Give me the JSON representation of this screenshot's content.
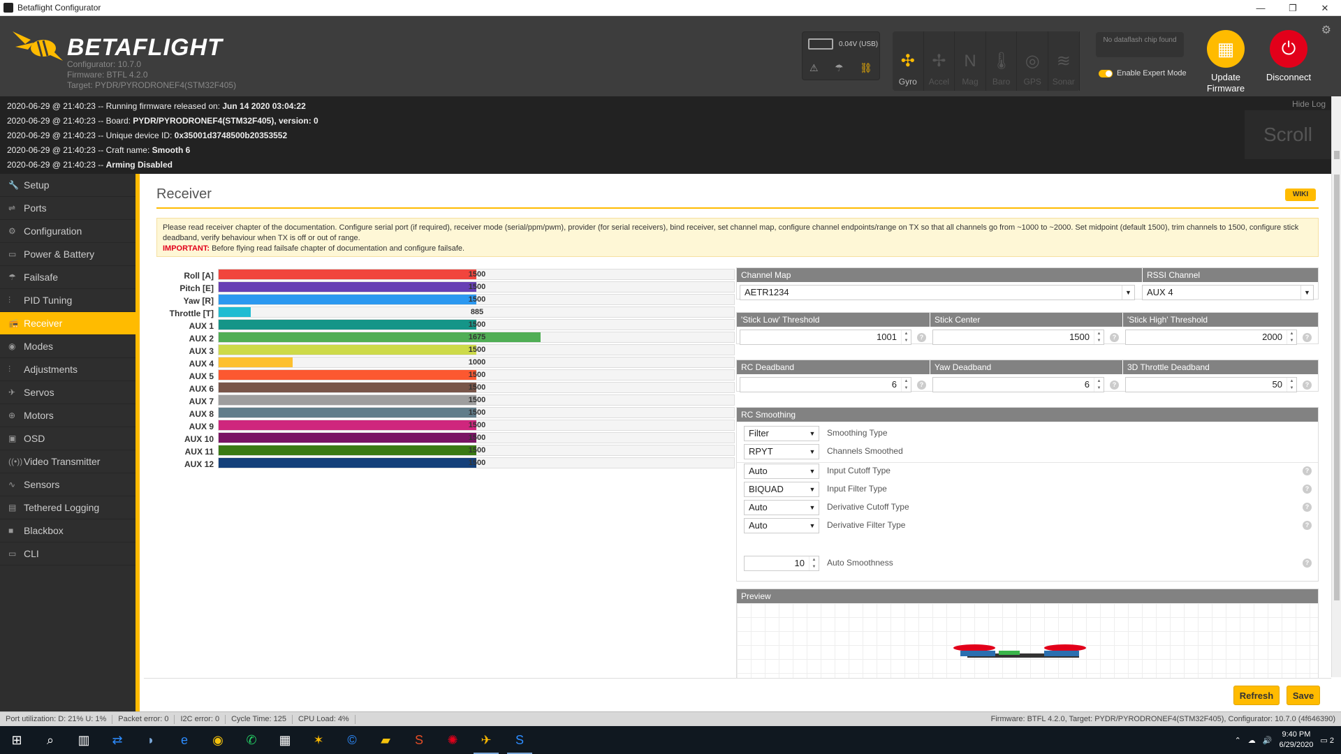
{
  "window": {
    "title": "Betaflight Configurator",
    "minimize": "—",
    "restore": "❐",
    "close": "✕"
  },
  "header": {
    "logo": "BETAFLIGHT",
    "configurator": "Configurator: 10.7.0",
    "firmware": "Firmware: BTFL 4.2.0",
    "target": "Target: PYDR/PYRODRONEF4(STM32F405)",
    "battery": "0.04V (USB)",
    "sensors": [
      {
        "label": "Gyro",
        "icon": "gyro-icon",
        "glyph": "✣",
        "active": true
      },
      {
        "label": "Accel",
        "icon": "accel-icon",
        "glyph": "✢",
        "active": false
      },
      {
        "label": "Mag",
        "icon": "mag-icon",
        "glyph": "N",
        "active": false
      },
      {
        "label": "Baro",
        "icon": "baro-icon",
        "glyph": "🌡",
        "active": false
      },
      {
        "label": "GPS",
        "icon": "gps-icon",
        "glyph": "◎",
        "active": false
      },
      {
        "label": "Sonar",
        "icon": "sonar-icon",
        "glyph": "≋",
        "active": false
      }
    ],
    "dataflash": "No dataflash chip found",
    "expert_mode": "Enable Expert Mode",
    "update_firmware": "Update Firmware",
    "disconnect": "Disconnect"
  },
  "log": {
    "hide_label": "Hide Log",
    "scroll_label": "Scroll",
    "lines": [
      {
        "prefix": "2020-06-29 @ 21:40:23 -- Running firmware released on: ",
        "bold": "Jun 14 2020 03:04:22"
      },
      {
        "prefix": "2020-06-29 @ 21:40:23 -- Board: ",
        "bold": "PYDR/PYRODRONEF4(STM32F405), version: 0"
      },
      {
        "prefix": "2020-06-29 @ 21:40:23 -- Unique device ID: ",
        "bold": "0x35001d3748500b20353552"
      },
      {
        "prefix": "2020-06-29 @ 21:40:23 -- Craft name: ",
        "bold": "Smooth 6"
      },
      {
        "prefix": "2020-06-29 @ 21:40:23 -- ",
        "bold": "Arming Disabled"
      }
    ]
  },
  "sidebar": {
    "items": [
      {
        "label": "Setup",
        "icon": "wrench-icon",
        "glyph": "🔧"
      },
      {
        "label": "Ports",
        "icon": "plug-icon",
        "glyph": "⇌"
      },
      {
        "label": "Configuration",
        "icon": "gear-icon",
        "glyph": "⚙"
      },
      {
        "label": "Power & Battery",
        "icon": "battery-icon",
        "glyph": "▭"
      },
      {
        "label": "Failsafe",
        "icon": "parachute-icon",
        "glyph": "☂"
      },
      {
        "label": "PID Tuning",
        "icon": "pid-icon",
        "glyph": "⫶"
      },
      {
        "label": "Receiver",
        "icon": "receiver-icon",
        "glyph": "📻",
        "active": true
      },
      {
        "label": "Modes",
        "icon": "modes-icon",
        "glyph": "◉"
      },
      {
        "label": "Adjustments",
        "icon": "sliders-icon",
        "glyph": "⫶"
      },
      {
        "label": "Servos",
        "icon": "servo-icon",
        "glyph": "✈"
      },
      {
        "label": "Motors",
        "icon": "motor-icon",
        "glyph": "⊕"
      },
      {
        "label": "OSD",
        "icon": "osd-icon",
        "glyph": "▣"
      },
      {
        "label": "Video Transmitter",
        "icon": "vtx-icon",
        "glyph": "((•))"
      },
      {
        "label": "Sensors",
        "icon": "sensors-icon",
        "glyph": "∿"
      },
      {
        "label": "Tethered Logging",
        "icon": "tethered-icon",
        "glyph": "▤"
      },
      {
        "label": "Blackbox",
        "icon": "blackbox-icon",
        "glyph": "■"
      },
      {
        "label": "CLI",
        "icon": "cli-icon",
        "glyph": "▭"
      }
    ]
  },
  "page": {
    "title": "Receiver",
    "wiki": "WIKI",
    "note": "Please read receiver chapter of the documentation. Configure serial port (if required), receiver mode (serial/ppm/pwm), provider (for serial receivers), bind receiver, set channel map, configure channel endpoints/range on TX so that all channels go from ~1000 to ~2000. Set midpoint (default 1500), trim channels to 1500, configure stick deadband, verify behaviour when TX is off or out of range.",
    "important_label": "IMPORTANT:",
    "important_text": " Before flying read failsafe chapter of documentation and configure failsafe."
  },
  "channels": [
    {
      "label": "Roll [A]",
      "value": "1500",
      "level": 0.5,
      "color": "#f1453d"
    },
    {
      "label": "Pitch [E]",
      "value": "1500",
      "level": 0.5,
      "color": "#673fb4"
    },
    {
      "label": "Yaw [R]",
      "value": "1500",
      "level": 0.5,
      "color": "#2b98f0"
    },
    {
      "label": "Throttle [T]",
      "value": "885",
      "level": 0.063,
      "color": "#1fbcd2"
    },
    {
      "label": "AUX 1",
      "value": "1500",
      "level": 0.5,
      "color": "#159588"
    },
    {
      "label": "AUX 2",
      "value": "1675",
      "level": 0.625,
      "color": "#50ae55"
    },
    {
      "label": "AUX 3",
      "value": "1500",
      "level": 0.5,
      "color": "#cdda49"
    },
    {
      "label": "AUX 4",
      "value": "1000",
      "level": 0.143,
      "color": "#fdc02f"
    },
    {
      "label": "AUX 5",
      "value": "1500",
      "level": 0.5,
      "color": "#fc5830"
    },
    {
      "label": "AUX 6",
      "value": "1500",
      "level": 0.5,
      "color": "#785549"
    },
    {
      "label": "AUX 7",
      "value": "1500",
      "level": 0.5,
      "color": "#9e9e9e"
    },
    {
      "label": "AUX 8",
      "value": "1500",
      "level": 0.5,
      "color": "#617d8a"
    },
    {
      "label": "AUX 9",
      "value": "1500",
      "level": 0.5,
      "color": "#cf267d"
    },
    {
      "label": "AUX 10",
      "value": "1500",
      "level": 0.5,
      "color": "#7a1464"
    },
    {
      "label": "AUX 11",
      "value": "1500",
      "level": 0.5,
      "color": "#3a7a14"
    },
    {
      "label": "AUX 12",
      "value": "1500",
      "level": 0.5,
      "color": "#14407a"
    }
  ],
  "settings": {
    "channel_map_title": "Channel Map",
    "channel_map": "AETR1234",
    "rssi_title": "RSSI Channel",
    "rssi": "AUX 4",
    "stick_low_title": "'Stick Low' Threshold",
    "stick_low": "1001",
    "stick_center_title": "Stick Center",
    "stick_center": "1500",
    "stick_high_title": "'Stick High' Threshold",
    "stick_high": "2000",
    "rc_deadband_title": "RC Deadband",
    "rc_deadband": "6",
    "yaw_deadband_title": "Yaw Deadband",
    "yaw_deadband": "6",
    "throttle_deadband_title": "3D Throttle Deadband",
    "throttle_deadband": "50"
  },
  "smoothing": {
    "title": "RC Smoothing",
    "rows": [
      {
        "value": "Filter",
        "label": "Smoothing Type",
        "help": false
      },
      {
        "value": "RPYT",
        "label": "Channels Smoothed",
        "help": false
      },
      {
        "value": "Auto",
        "label": "Input Cutoff Type",
        "help": true
      },
      {
        "value": "BIQUAD",
        "label": "Input Filter Type",
        "help": true
      },
      {
        "value": "Auto",
        "label": "Derivative Cutoff Type",
        "help": true
      },
      {
        "value": "Auto",
        "label": "Derivative Filter Type",
        "help": true
      }
    ],
    "auto_smoothness_value": "10",
    "auto_smoothness_label": "Auto Smoothness"
  },
  "preview": {
    "title": "Preview"
  },
  "buttons": {
    "refresh": "Refresh",
    "save": "Save"
  },
  "status": {
    "port": "Port utilization: D: 21% U: 1%",
    "packet": "Packet error: 0",
    "i2c": "I2C error: 0",
    "cycle": "Cycle Time: 125",
    "cpu": "CPU Load: 4%",
    "firmware": "Firmware: BTFL 4.2.0, Target: PYDR/PYRODRONEF4(STM32F405), Configurator: 10.7.0 (4f646390)"
  },
  "taskbar": {
    "time": "9:40 PM",
    "date": "6/29/2020",
    "notifications": "2"
  }
}
